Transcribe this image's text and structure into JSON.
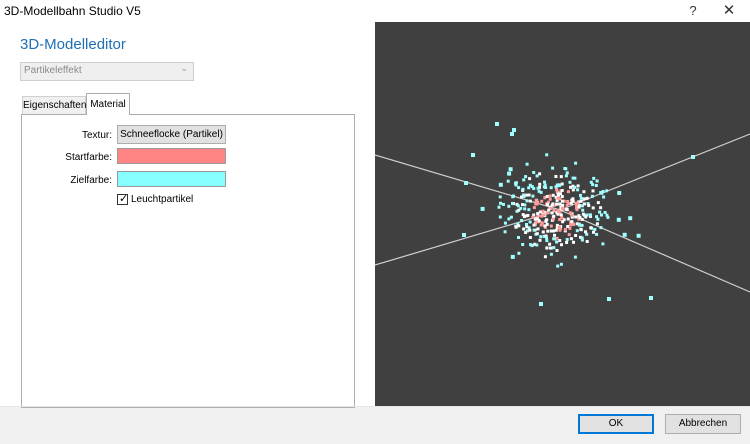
{
  "window": {
    "title": "3D-Modellbahn Studio V5",
    "help_symbol": "?",
    "close_symbol": "✕"
  },
  "editor": {
    "heading": "3D-Modelleditor",
    "combo_value": "Partikeleffekt",
    "combo_arrow_icon": "chevron-down-icon"
  },
  "tabs": [
    {
      "label": "Eigenschaften",
      "active": false
    },
    {
      "label": "Material",
      "active": true
    }
  ],
  "material": {
    "texture_label": "Textur:",
    "texture_button": "Schneeflocke (Partikel)",
    "start_color_label": "Startfarbe:",
    "start_color": "#ff8585",
    "end_color_label": "Zielfarbe:",
    "end_color": "#88ffff",
    "glow_checkbox_label": "Leuchtpartikel",
    "glow_checked": true
  },
  "viewport": {
    "background": "#404040",
    "axis_color": "#cfcfcf",
    "particle_colors": [
      "#9fffff",
      "#ffffff",
      "#ff9a9a"
    ]
  },
  "buttons": {
    "ok": "OK",
    "cancel": "Abbrechen"
  }
}
